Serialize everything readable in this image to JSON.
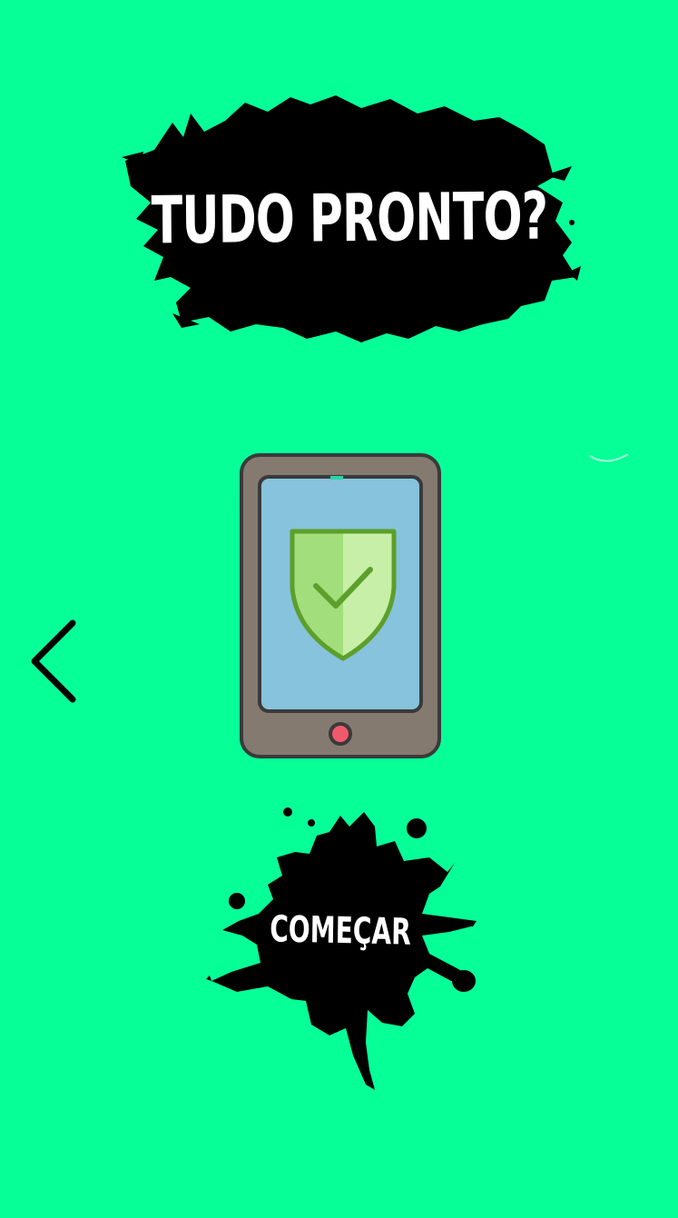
{
  "screen": {
    "title": "TUDO PRONTO?",
    "start_button_label": "COMEÇAR"
  },
  "colors": {
    "background": "#07FF98",
    "ink": "#000000",
    "title_text": "#FFFFFF",
    "phone_body": "#857A6F",
    "phone_outline": "#3A3A3A",
    "screen_blue": "#87C3DC",
    "shield_light": "#C7EFA7",
    "shield_mid": "#A2DE7B",
    "shield_outline": "#5C9F2A",
    "home_button": "#F0596C"
  },
  "icons": {
    "back": "chevron-left-icon",
    "illustration": "phone-shield-check-icon"
  }
}
